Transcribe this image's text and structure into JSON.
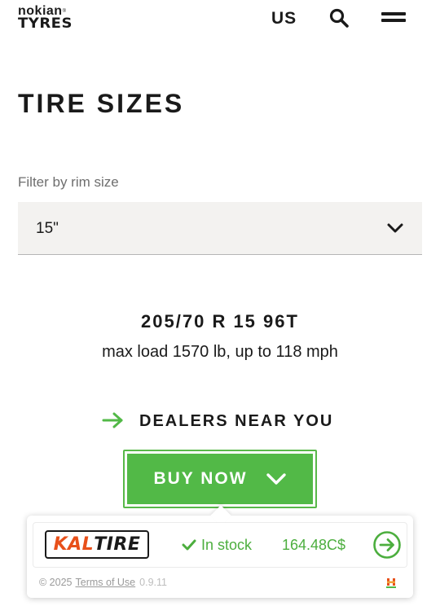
{
  "header": {
    "logo_top": "nokian",
    "logo_reg": "®",
    "logo_bottom": "TYRES",
    "region": "US",
    "search_icon": "search-icon",
    "menu_icon": "hamburger-menu-icon"
  },
  "page": {
    "title": "TIRE SIZES"
  },
  "filter": {
    "label": "Filter by rim size",
    "selected": "15\"",
    "dropdown_icon": "chevron-down-icon"
  },
  "tire": {
    "size": "205/70 R 15 96T",
    "spec": "max load 1570 lb, up to 118 mph"
  },
  "dealers": {
    "label": "DEALERS NEAR YOU",
    "icon": "arrow-right-icon"
  },
  "buy": {
    "label": "BUY NOW",
    "icon": "chevron-down-icon"
  },
  "popup": {
    "retailer_kal": "KAL",
    "retailer_tire": "TIRE",
    "stock_icon": "check-icon",
    "stock_text": "In stock",
    "price": "164.48C$",
    "go_icon": "arrow-circle-right-icon",
    "copyright": "© 2025",
    "terms": "Terms of Use",
    "version": "0.9.11"
  },
  "colors": {
    "accent_green": "#52b947",
    "text_green": "#4cae3e",
    "retailer_orange": "#e8501a",
    "select_bg": "#f3f2f0"
  }
}
